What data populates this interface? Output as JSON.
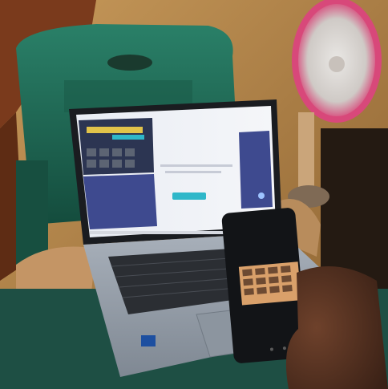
{
  "scene": {
    "description_free": true,
    "laptop": {
      "screen_banner": "",
      "screen_button": "",
      "side_panel_bar": ""
    },
    "phone": {
      "status_time": "",
      "video_participants": 12
    },
    "colors": {
      "wall": "#b98a4a",
      "curtain": "#7a3a1c",
      "chair": "#1f6f5a",
      "laptop_body": "#9aa3ad",
      "keyboard": "#2b2e33",
      "screen_light": "#eef1f6",
      "screen_dark": "#3e4a8f",
      "teal_accent": "#2fb7c9",
      "phone_body": "#121417",
      "fan_pink": "#d8487a",
      "hand": "#5a3322"
    }
  }
}
